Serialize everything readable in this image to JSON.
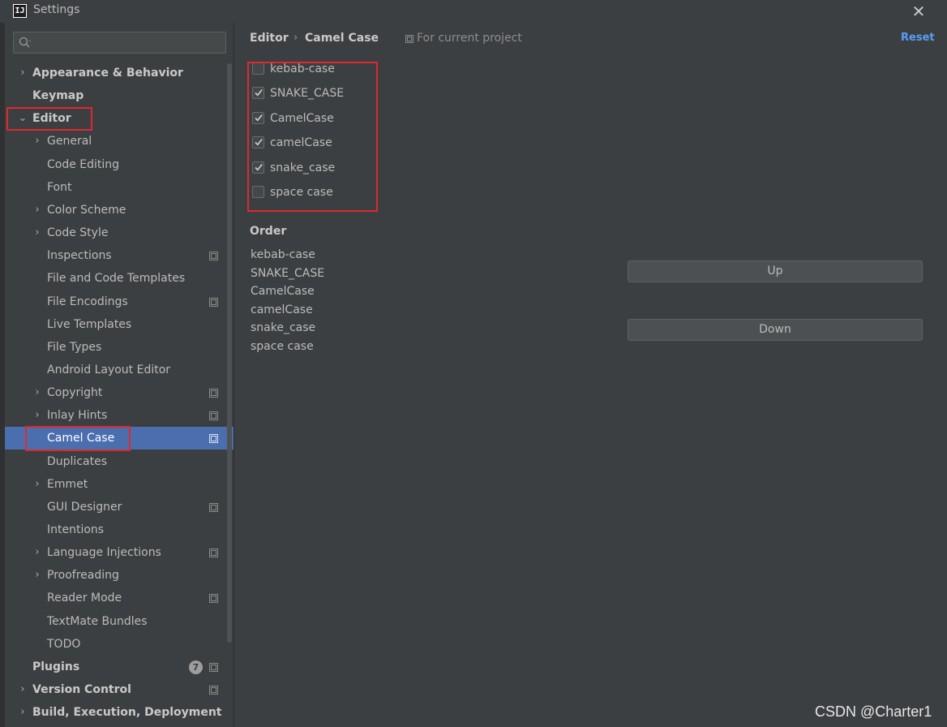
{
  "window": {
    "app_icon_text": "IJ",
    "title": "Settings",
    "close_glyph": "✕"
  },
  "search": {
    "value": "",
    "placeholder": "",
    "icon": "search-icon"
  },
  "sidebar": {
    "items": [
      {
        "label": "Appearance & Behavior",
        "arrow": "›",
        "bold": true
      },
      {
        "label": "Keymap",
        "arrow": "",
        "bold": true
      },
      {
        "label": "Editor",
        "arrow": "⌄",
        "bold": true
      },
      {
        "label": "General",
        "arrow": "›"
      },
      {
        "label": "Code Editing",
        "arrow": ""
      },
      {
        "label": "Font",
        "arrow": ""
      },
      {
        "label": "Color Scheme",
        "arrow": "›"
      },
      {
        "label": "Code Style",
        "arrow": "›"
      },
      {
        "label": "Inspections",
        "arrow": "",
        "project_icon": true
      },
      {
        "label": "File and Code Templates",
        "arrow": ""
      },
      {
        "label": "File Encodings",
        "arrow": "",
        "project_icon": true
      },
      {
        "label": "Live Templates",
        "arrow": ""
      },
      {
        "label": "File Types",
        "arrow": ""
      },
      {
        "label": "Android Layout Editor",
        "arrow": ""
      },
      {
        "label": "Copyright",
        "arrow": "›",
        "project_icon": true
      },
      {
        "label": "Inlay Hints",
        "arrow": "›",
        "project_icon": true
      },
      {
        "label": "Camel Case",
        "arrow": "",
        "project_icon": true,
        "selected": true
      },
      {
        "label": "Duplicates",
        "arrow": ""
      },
      {
        "label": "Emmet",
        "arrow": "›"
      },
      {
        "label": "GUI Designer",
        "arrow": "",
        "project_icon": true
      },
      {
        "label": "Intentions",
        "arrow": ""
      },
      {
        "label": "Language Injections",
        "arrow": "›",
        "project_icon": true
      },
      {
        "label": "Proofreading",
        "arrow": "›"
      },
      {
        "label": "Reader Mode",
        "arrow": "",
        "project_icon": true
      },
      {
        "label": "TextMate Bundles",
        "arrow": ""
      },
      {
        "label": "TODO",
        "arrow": ""
      },
      {
        "label": "Plugins",
        "arrow": "",
        "bold": true,
        "badge": "7",
        "project_icon": true
      },
      {
        "label": "Version Control",
        "arrow": "›",
        "bold": true,
        "project_icon": true
      },
      {
        "label": "Build, Execution, Deployment",
        "arrow": "›",
        "bold": true
      }
    ]
  },
  "header": {
    "breadcrumb_parent": "Editor",
    "breadcrumb_sep": "›",
    "breadcrumb_current": "Camel Case",
    "scope_label": "For current project",
    "reset_label": "Reset"
  },
  "styles": [
    {
      "label": "kebab-case",
      "checked": false
    },
    {
      "label": "SNAKE_CASE",
      "checked": true
    },
    {
      "label": "CamelCase",
      "checked": true
    },
    {
      "label": "camelCase",
      "checked": true
    },
    {
      "label": "snake_case",
      "checked": true
    },
    {
      "label": "space case",
      "checked": false
    }
  ],
  "order": {
    "heading": "Order",
    "items": [
      "kebab-case",
      "SNAKE_CASE",
      "CamelCase",
      "camelCase",
      "snake_case",
      "space case"
    ],
    "up_label": "Up",
    "down_label": "Down"
  },
  "watermark": "CSDN @Charter1",
  "colors": {
    "background": "#3c3f41",
    "selection": "#4b6eaf",
    "link": "#589df6",
    "highlight_box": "#e0282d",
    "text": "#bbbbbb"
  }
}
